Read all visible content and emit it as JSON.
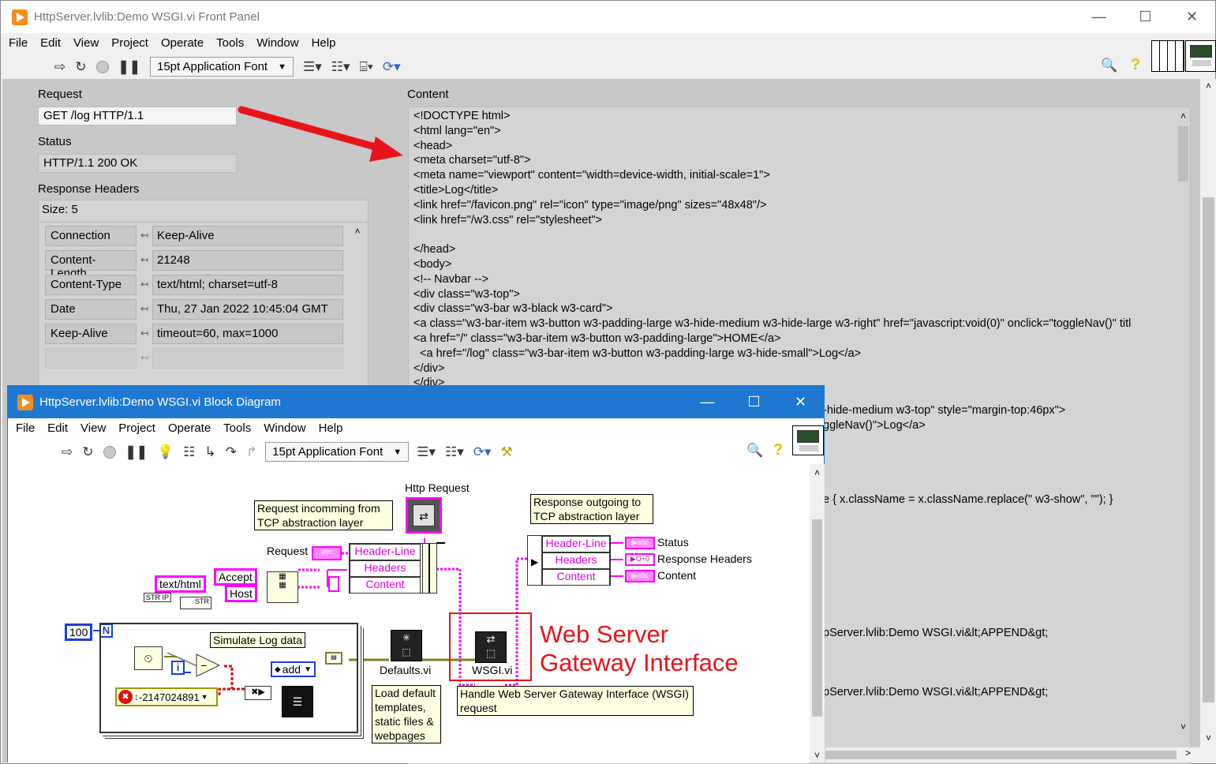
{
  "front_panel": {
    "title": "HttpServer.lvlib:Demo WSGI.vi Front Panel",
    "menu": [
      "File",
      "Edit",
      "View",
      "Project",
      "Operate",
      "Tools",
      "Window",
      "Help"
    ],
    "font_select": "15pt Application Font",
    "request_label": "Request",
    "request_value": "GET /log HTTP/1.1",
    "status_label": "Status",
    "status_value": "HTTP/1.1 200 OK",
    "response_headers_label": "Response Headers",
    "size_text": "Size: 5",
    "headers": [
      {
        "key": "Connection",
        "value": "Keep-Alive"
      },
      {
        "key": "Content-Length",
        "value": "21248"
      },
      {
        "key": "Content-Type",
        "value": "text/html; charset=utf-8"
      },
      {
        "key": "Date",
        "value": "Thu, 27 Jan 2022 10:45:04 GMT"
      },
      {
        "key": "Keep-Alive",
        "value": "timeout=60, max=1000"
      }
    ],
    "content_label": "Content",
    "content_lines": [
      "<!DOCTYPE html>",
      "<html lang=\"en\">",
      "<head>",
      "<meta charset=\"utf-8\">",
      "<meta name=\"viewport\" content=\"width=device-width, initial-scale=1\">",
      "<title>Log</title>",
      "<link href=\"/favicon.png\" rel=\"icon\" type=\"image/png\" sizes=\"48x48\"/>",
      "<link href=\"/w3.css\" rel=\"stylesheet\">",
      "",
      "</head>",
      "<body>",
      "<!-- Navbar -->",
      "<div class=\"w3-top\">",
      "<div class=\"w3-bar w3-black w3-card\">",
      "<a class=\"w3-bar-item w3-button w3-padding-large w3-hide-medium w3-hide-large w3-right\" href=\"javascript:void(0)\" onclick=\"toggleNav()\" titl",
      "<a href=\"/\" class=\"w3-bar-item w3-button w3-padding-large\">HOME</a>",
      "  <a href=\"/log\" class=\"w3-bar-item w3-button w3-padding-large w3-hide-small\">Log</a>",
      "</div>",
      "</div>"
    ],
    "content_partial_lines": [
      {
        "row": 20,
        "text": "-hide-medium w3-top\" style=\"margin-top:46px\">"
      },
      {
        "row": 21,
        "text": "ggleNav()\">Log</a>"
      },
      {
        "row": 26,
        "text": "e { x.className = x.className.replace(\" w3-show\", \"\"); }"
      },
      {
        "row": 35,
        "text": "pServer.lvlib:Demo WSGI.vi&lt;APPEND&gt;"
      },
      {
        "row": 39,
        "text": "pServer.lvlib:Demo WSGI.vi&lt;APPEND&gt;"
      }
    ]
  },
  "block_diagram": {
    "title": "HttpServer.lvlib:Demo WSGI.vi Block Diagram",
    "menu": [
      "File",
      "Edit",
      "View",
      "Project",
      "Operate",
      "Tools",
      "Window",
      "Help"
    ],
    "font_select": "15pt Application Font",
    "http_request_label": "Http Request",
    "comment_request": [
      "Request incomming from",
      "TCP abstraction layer"
    ],
    "comment_response": [
      "Response outgoing to",
      "TCP abstraction layer"
    ],
    "request_label": "Request",
    "unbundle_items": [
      "Header-Line",
      "Headers",
      "Content"
    ],
    "bundle_items": [
      "Header-Line",
      "Headers",
      "Content"
    ],
    "out_labels": [
      "Status",
      "Response Headers",
      "Content"
    ],
    "text_html": "text/html",
    "accept": "Accept",
    "host": "Host",
    "str_ip": "STR  IP",
    "ip_str": "STR",
    "loop_count": "100",
    "loop_n": "N",
    "loop_i": "i",
    "simulate_comment": "Simulate Log data",
    "error_code": "-2147024891",
    "add_label": "add",
    "defaults_vi": "Defaults.vi",
    "wsgi_vi": "WSGI.vi",
    "defaults_comment": [
      "Load default",
      "templates,",
      "static files &",
      "webpages"
    ],
    "wsgi_comment": [
      "Handle Web Server Gateway Interface (WSGI)",
      "request"
    ],
    "annotation_line1": "Web Server",
    "annotation_line2": "Gateway Interface",
    "annotation_color": "#e8141b"
  }
}
